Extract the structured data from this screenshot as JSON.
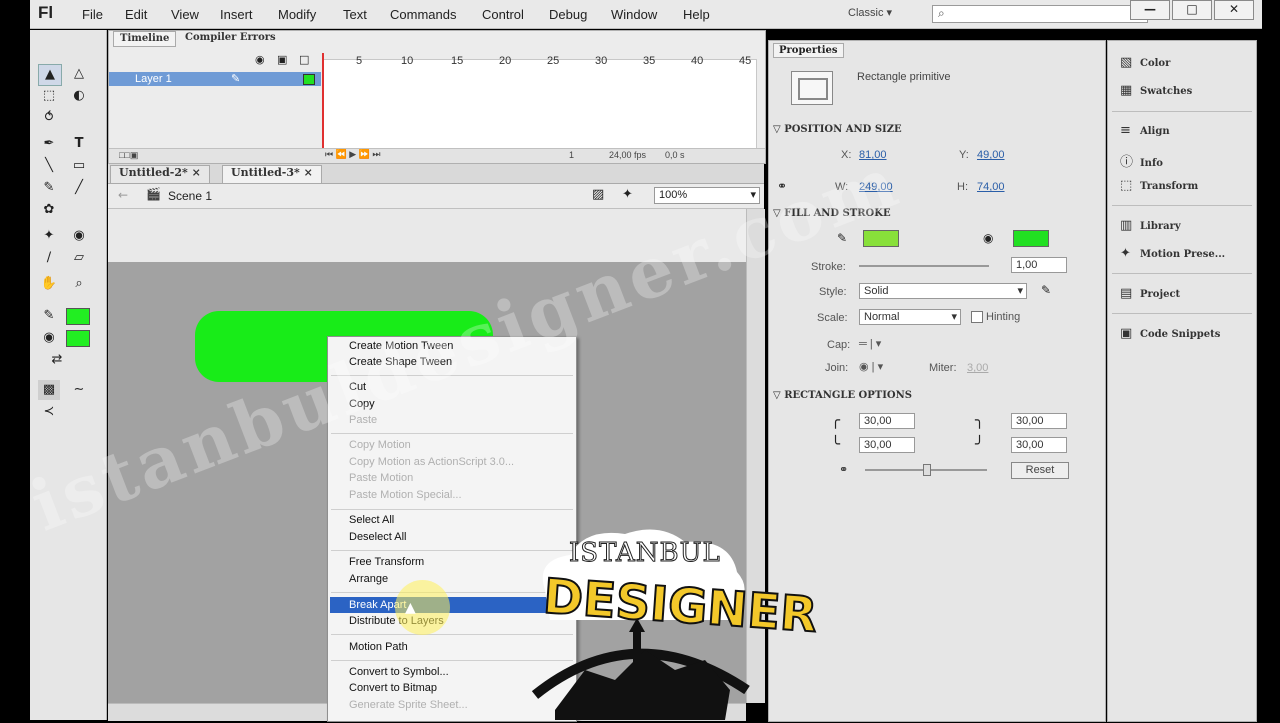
{
  "app": {
    "logo": "Fl"
  },
  "menu": [
    "File",
    "Edit",
    "View",
    "Insert",
    "Modify",
    "Text",
    "Commands",
    "Control",
    "Debug",
    "Window",
    "Help"
  ],
  "workspace": "Classic ▾",
  "search_glyph": "⌕",
  "window_controls": [
    "—",
    "□",
    "✕"
  ],
  "timeline": {
    "tabs": [
      "Timeline",
      "Compiler Errors"
    ],
    "layer_name": "Layer 1",
    "frame_numbers": [
      "5",
      "10",
      "15",
      "20",
      "25",
      "30",
      "35",
      "40",
      "45"
    ],
    "fps": "24,00 fps",
    "time": "0,0 s",
    "frame": "1"
  },
  "doc_tabs": [
    "Untitled-2*",
    "Untitled-3*"
  ],
  "edit_bar": {
    "scene": "Scene 1",
    "zoom": "100%"
  },
  "context_menu": [
    {
      "label": "Create Motion Tween",
      "enabled": true
    },
    {
      "label": "Create Shape Tween",
      "enabled": true
    },
    {
      "label": "Cut",
      "enabled": true
    },
    {
      "label": "Copy",
      "enabled": true
    },
    {
      "label": "Paste",
      "enabled": false
    },
    {
      "label": "Copy Motion",
      "enabled": false
    },
    {
      "label": "Copy Motion as ActionScript 3.0...",
      "enabled": false
    },
    {
      "label": "Paste Motion",
      "enabled": false
    },
    {
      "label": "Paste Motion Special...",
      "enabled": false
    },
    {
      "label": "Select All",
      "enabled": true
    },
    {
      "label": "Deselect All",
      "enabled": true
    },
    {
      "label": "Free Transform",
      "enabled": true
    },
    {
      "label": "Arrange",
      "enabled": true
    },
    {
      "label": "Break Apart",
      "enabled": true,
      "selected": true
    },
    {
      "label": "Distribute to Layers",
      "enabled": true
    },
    {
      "label": "Motion Path",
      "enabled": true
    },
    {
      "label": "Convert to Symbol...",
      "enabled": true
    },
    {
      "label": "Convert to Bitmap",
      "enabled": true
    },
    {
      "label": "Generate Sprite Sheet...",
      "enabled": false
    }
  ],
  "properties": {
    "tab": "Properties",
    "object_type": "Rectangle primitive",
    "pos_size": {
      "header": "POSITION AND SIZE",
      "x_label": "X:",
      "x": "81,00",
      "y_label": "Y:",
      "y": "49,00",
      "w_label": "W:",
      "w": "249,00",
      "h_label": "H:",
      "h": "74,00"
    },
    "fill_stroke": {
      "header": "FILL AND STROKE",
      "stroke_label": "Stroke:",
      "stroke": "1,00",
      "style_label": "Style:",
      "style": "Solid",
      "scale_label": "Scale:",
      "scale": "Normal",
      "hinting": "Hinting",
      "cap_label": "Cap:",
      "join_label": "Join:",
      "miter_label": "Miter:",
      "miter": "3,00",
      "stroke_color": "#22e022",
      "fill_color": "#22e022"
    },
    "rect_options": {
      "header": "RECTANGLE OPTIONS",
      "tl": "30,00",
      "tr": "30,00",
      "bl": "30,00",
      "br": "30,00",
      "reset": "Reset"
    }
  },
  "dock": [
    {
      "icon": "color-icon",
      "glyph": "▧",
      "label": "Color"
    },
    {
      "icon": "swatches-icon",
      "glyph": "▦",
      "label": "Swatches"
    },
    {
      "icon": "align-icon",
      "glyph": "≡",
      "label": "Align"
    },
    {
      "icon": "info-icon",
      "glyph": "ⓘ",
      "label": "Info"
    },
    {
      "icon": "transform-icon",
      "glyph": "⬚",
      "label": "Transform"
    },
    {
      "icon": "library-icon",
      "glyph": "▥",
      "label": "Library"
    },
    {
      "icon": "motion-presets-icon",
      "glyph": "✦",
      "label": "Motion Prese..."
    },
    {
      "icon": "project-icon",
      "glyph": "▤",
      "label": "Project"
    },
    {
      "icon": "code-snippets-icon",
      "glyph": "▣",
      "label": "Code Snippets"
    }
  ],
  "watermark": "istanbuldesigner.com",
  "overlay_logo": {
    "line1": "ISTANBUL",
    "line2": "DESIGNER"
  },
  "colors": {
    "stage_shape": "#18ec18",
    "selection": "#2b63c4",
    "layer_highlight": "#6f9bd6"
  }
}
